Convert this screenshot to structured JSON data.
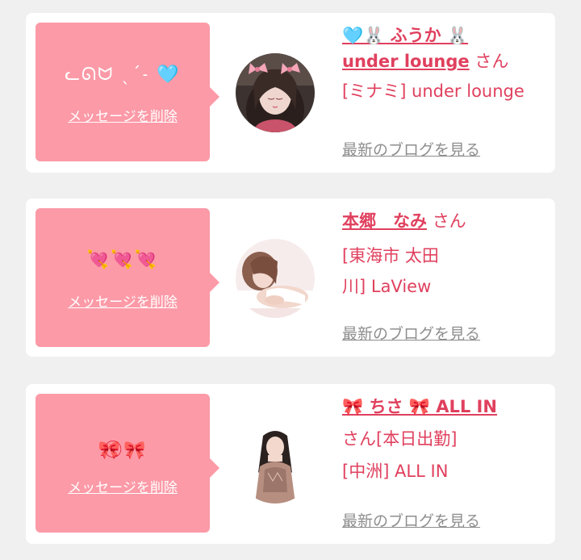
{
  "colors": {
    "page_bg": "#f0f0f0",
    "card_bg": "#ffffff",
    "bubble_pink": "#fc9aa7",
    "accent_pink": "#e0405e",
    "link_gray": "#8e8e8e"
  },
  "entries": [
    {
      "message": "ᓚᘏᗢ ˎˊ˗ 🩵",
      "delete_label": "メッセージを削除",
      "name": "🩵🐰 ふうか 🐰 under lounge",
      "name_part1": "🩵🐰 ふうか 🐰",
      "name_part2": "under lounge",
      "honorific": "さん",
      "shop": "[ミナミ] under lounge",
      "blog_label": "最新のブログを見る",
      "avatar_icon": "bunny-ears-girl-avatar"
    },
    {
      "message": "💘💘💘",
      "delete_label": "メッセージを削除",
      "name": "本郷　なみ",
      "honorific": "さん",
      "shop_line1": "[東海市 太田",
      "shop_line2": "川] LaView",
      "blog_label": "最新のブログを見る",
      "avatar_icon": "lying-woman-avatar"
    },
    {
      "message": "🎀⃝🎀",
      "delete_label": "メッセージを削除",
      "name": "🎀 ちさ 🎀 ALL IN",
      "honorific_status": "さん[本日出勤]",
      "shop": "[中洲] ALL IN",
      "blog_label": "最新のブログを見る",
      "avatar_icon": "standing-woman-avatar"
    }
  ]
}
